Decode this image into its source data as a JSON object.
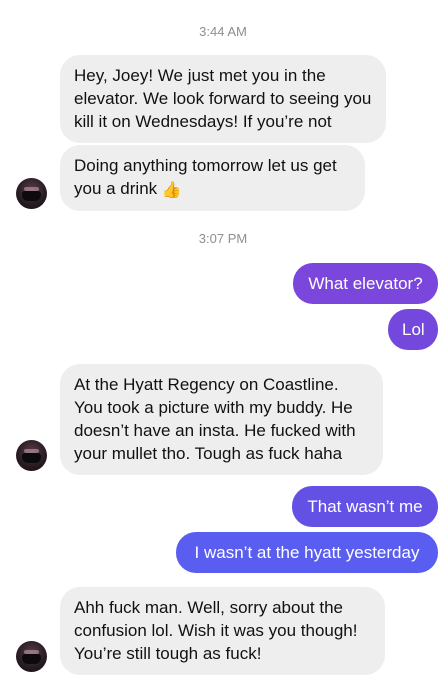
{
  "timestamps": [
    "3:44 AM",
    "3:07 PM"
  ],
  "messages": [
    {
      "sender": "them",
      "text": "Hey, Joey! We just met you in the elevator. We look forward to seeing you kill it on Wednesdays! If you’re not"
    },
    {
      "sender": "them",
      "text": "Doing anything tomorrow let us get you a drink",
      "emoji": "👍"
    },
    {
      "sender": "me",
      "text": "What elevator?"
    },
    {
      "sender": "me",
      "text": "Lol"
    },
    {
      "sender": "them",
      "text": "At the Hyatt Regency on Coastline. You took a picture with my buddy. He doesn’t have an insta. He fucked with your mullet tho. Tough as fuck haha"
    },
    {
      "sender": "me",
      "text": "That wasn’t me"
    },
    {
      "sender": "me",
      "text": "I wasn’t at the hyatt yesterday"
    },
    {
      "sender": "them",
      "text": "Ahh fuck man. Well, sorry about the confusion lol. Wish it was you though! You’re still tough as fuck!"
    }
  ],
  "colors": {
    "incoming_bubble": "#eeeeef",
    "outgoing_gradient_purple": "#7b45db",
    "outgoing_gradient_blue": "#5a5ff0"
  },
  "icons": {
    "avatar": "contact-avatar",
    "emoji": "thumbs-up"
  }
}
